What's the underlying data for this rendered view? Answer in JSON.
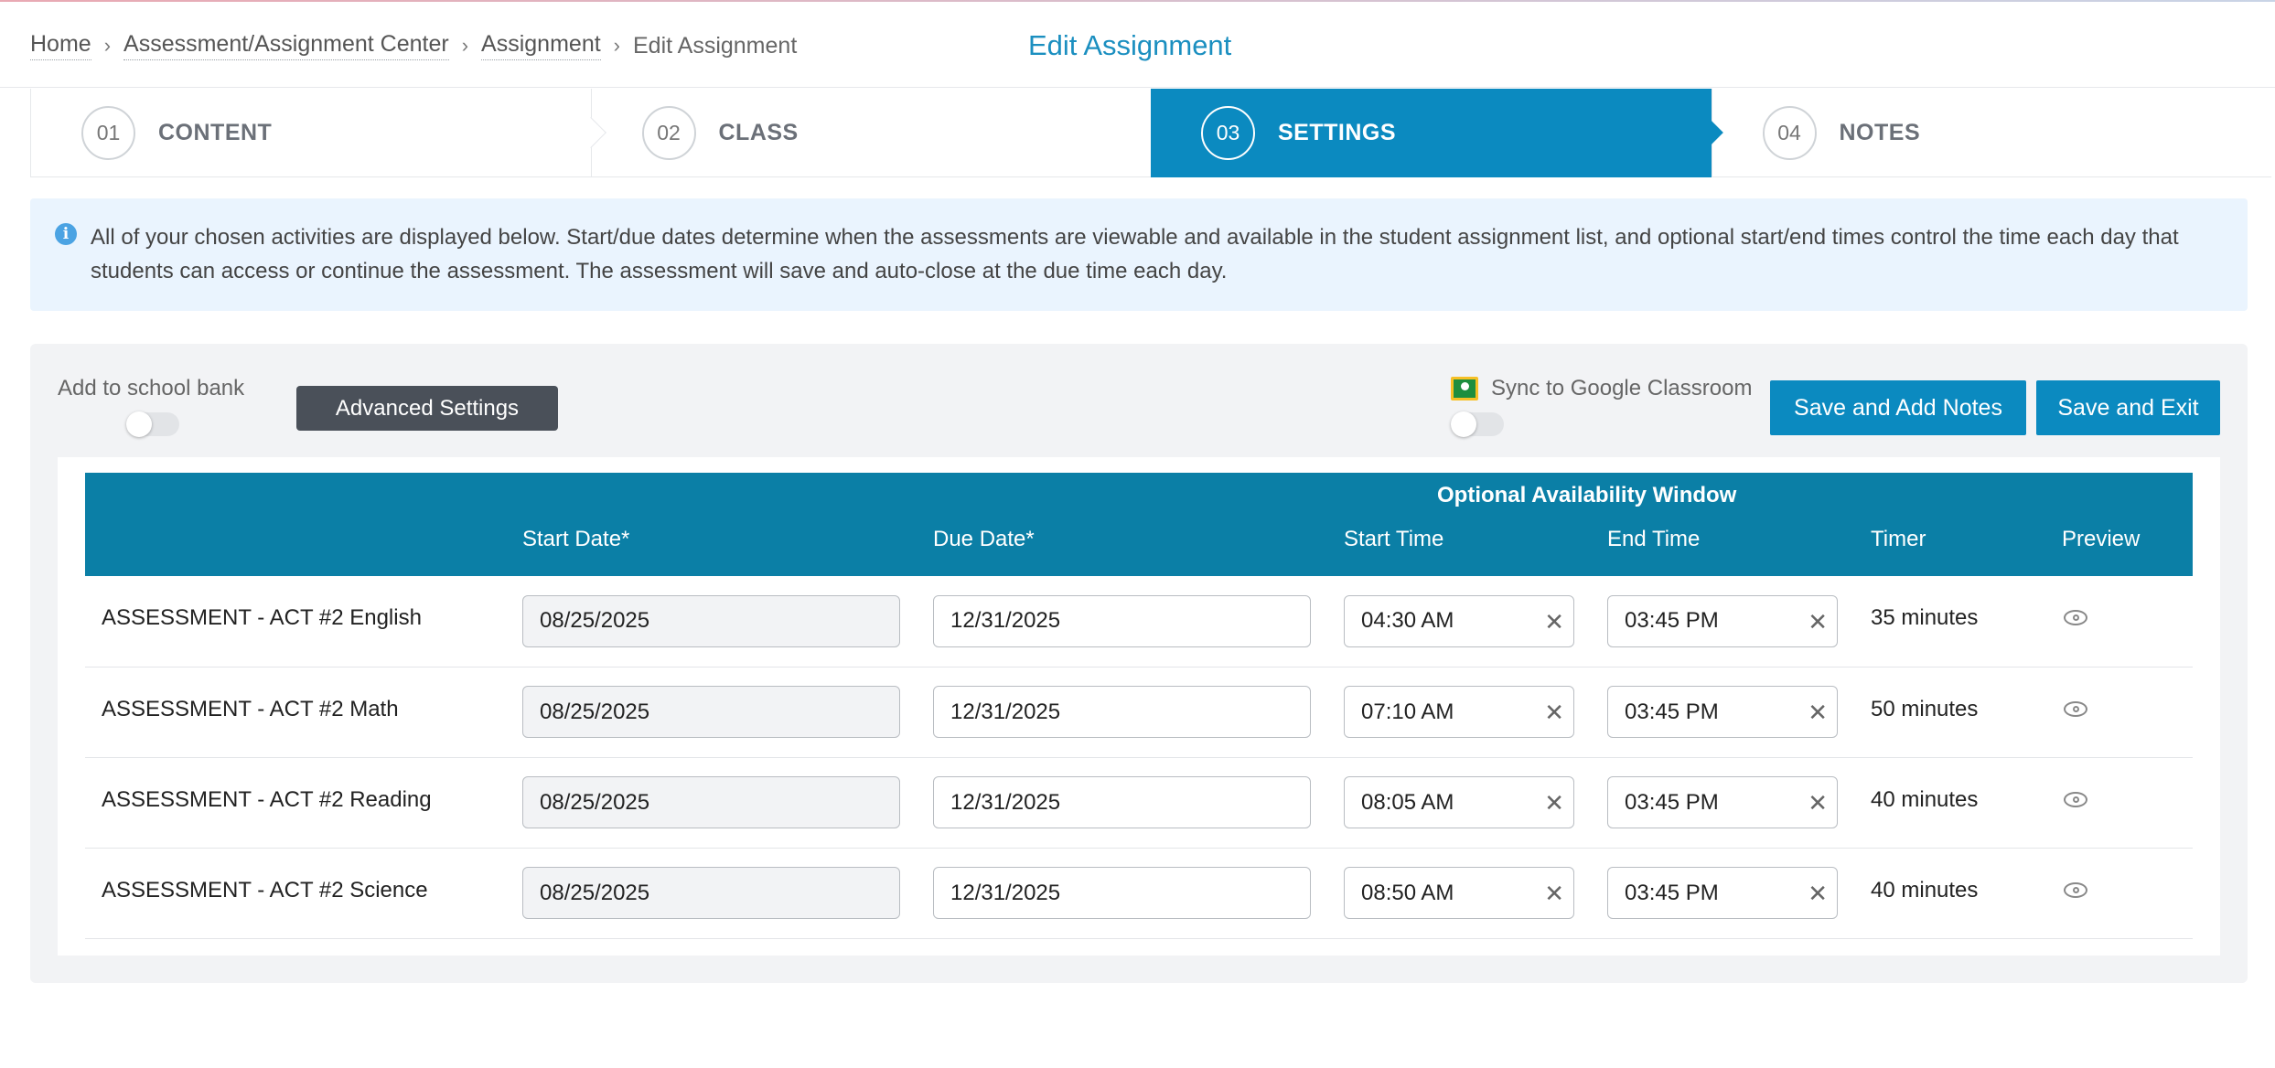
{
  "breadcrumb": {
    "items": [
      "Home",
      "Assessment/Assignment Center",
      "Assignment"
    ],
    "current": "Edit Assignment"
  },
  "page_title": "Edit Assignment",
  "steps": [
    {
      "num": "01",
      "label": "CONTENT",
      "active": false
    },
    {
      "num": "02",
      "label": "CLASS",
      "active": false
    },
    {
      "num": "03",
      "label": "SETTINGS",
      "active": true
    },
    {
      "num": "04",
      "label": "NOTES",
      "active": false
    }
  ],
  "info": {
    "icon": "info-icon",
    "text": "All of your chosen activities are displayed below. Start/due dates determine when the assessments are viewable and available in the student assignment list, and optional start/end times control the time each day that students can access or continue the assessment. The assessment will save and auto-close at the due time each day."
  },
  "toolbar": {
    "bank_label": "Add to school bank",
    "bank_toggle_on": false,
    "advanced_label": "Advanced Settings",
    "gc_label": "Sync to Google Classroom",
    "gc_toggle_on": false,
    "save_notes_label": "Save and Add Notes",
    "save_exit_label": "Save and Exit"
  },
  "table": {
    "group_header": "Optional Availability Window",
    "columns": [
      "",
      "Start Date*",
      "Due Date*",
      "Start Time",
      "End Time",
      "Timer",
      "Preview"
    ],
    "rows": [
      {
        "name": "ASSESSMENT - ACT #2 English",
        "start_date": "08/25/2025",
        "due_date": "12/31/2025",
        "start_time": "04:30 AM",
        "end_time": "03:45 PM",
        "timer": "35 minutes"
      },
      {
        "name": "ASSESSMENT - ACT #2 Math",
        "start_date": "08/25/2025",
        "due_date": "12/31/2025",
        "start_time": "07:10 AM",
        "end_time": "03:45 PM",
        "timer": "50 minutes"
      },
      {
        "name": "ASSESSMENT - ACT #2 Reading",
        "start_date": "08/25/2025",
        "due_date": "12/31/2025",
        "start_time": "08:05 AM",
        "end_time": "03:45 PM",
        "timer": "40 minutes"
      },
      {
        "name": "ASSESSMENT - ACT #2 Science",
        "start_date": "08/25/2025",
        "due_date": "12/31/2025",
        "start_time": "08:50 AM",
        "end_time": "03:45 PM",
        "timer": "40 minutes"
      }
    ]
  },
  "colors": {
    "accent": "#0b8ac0",
    "table_header": "#0b7fa6",
    "title": "#1b8fc0",
    "info_bg": "#eaf4fe",
    "dark_button": "#4a5059"
  }
}
